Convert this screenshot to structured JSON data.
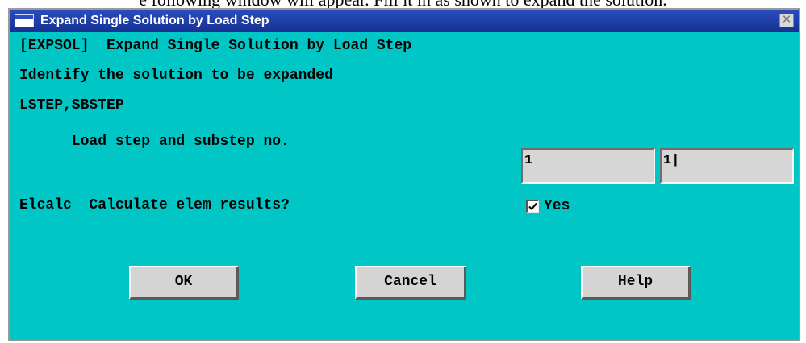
{
  "page": {
    "caption": "e following window will appear. Fill it in as shown to expand the solution."
  },
  "window": {
    "title": "Expand Single Solution by Load Step",
    "close_glyph": "✕"
  },
  "form": {
    "line1": "[EXPSOL]  Expand Single Solution by Load Step",
    "line2": "Identify the solution to be expanded",
    "line3": "LSTEP,SBSTEP",
    "line4": "      Load step and substep no.",
    "lstep_value": "1",
    "sbstep_value": "1|",
    "line5": "Elcalc  Calculate elem results?",
    "elcalc_checked": true,
    "elcalc_label": "Yes"
  },
  "buttons": {
    "ok": "OK",
    "cancel": "Cancel",
    "help": "Help"
  },
  "colors": {
    "dialog_bg": "#00c6c6",
    "titlebar": "#1b3aa0",
    "button_face": "#d4d4d4",
    "field_bg": "#d6d6d6"
  },
  "icons": {
    "window": "window-icon",
    "close": "close-icon",
    "check": "checkmark-icon"
  }
}
